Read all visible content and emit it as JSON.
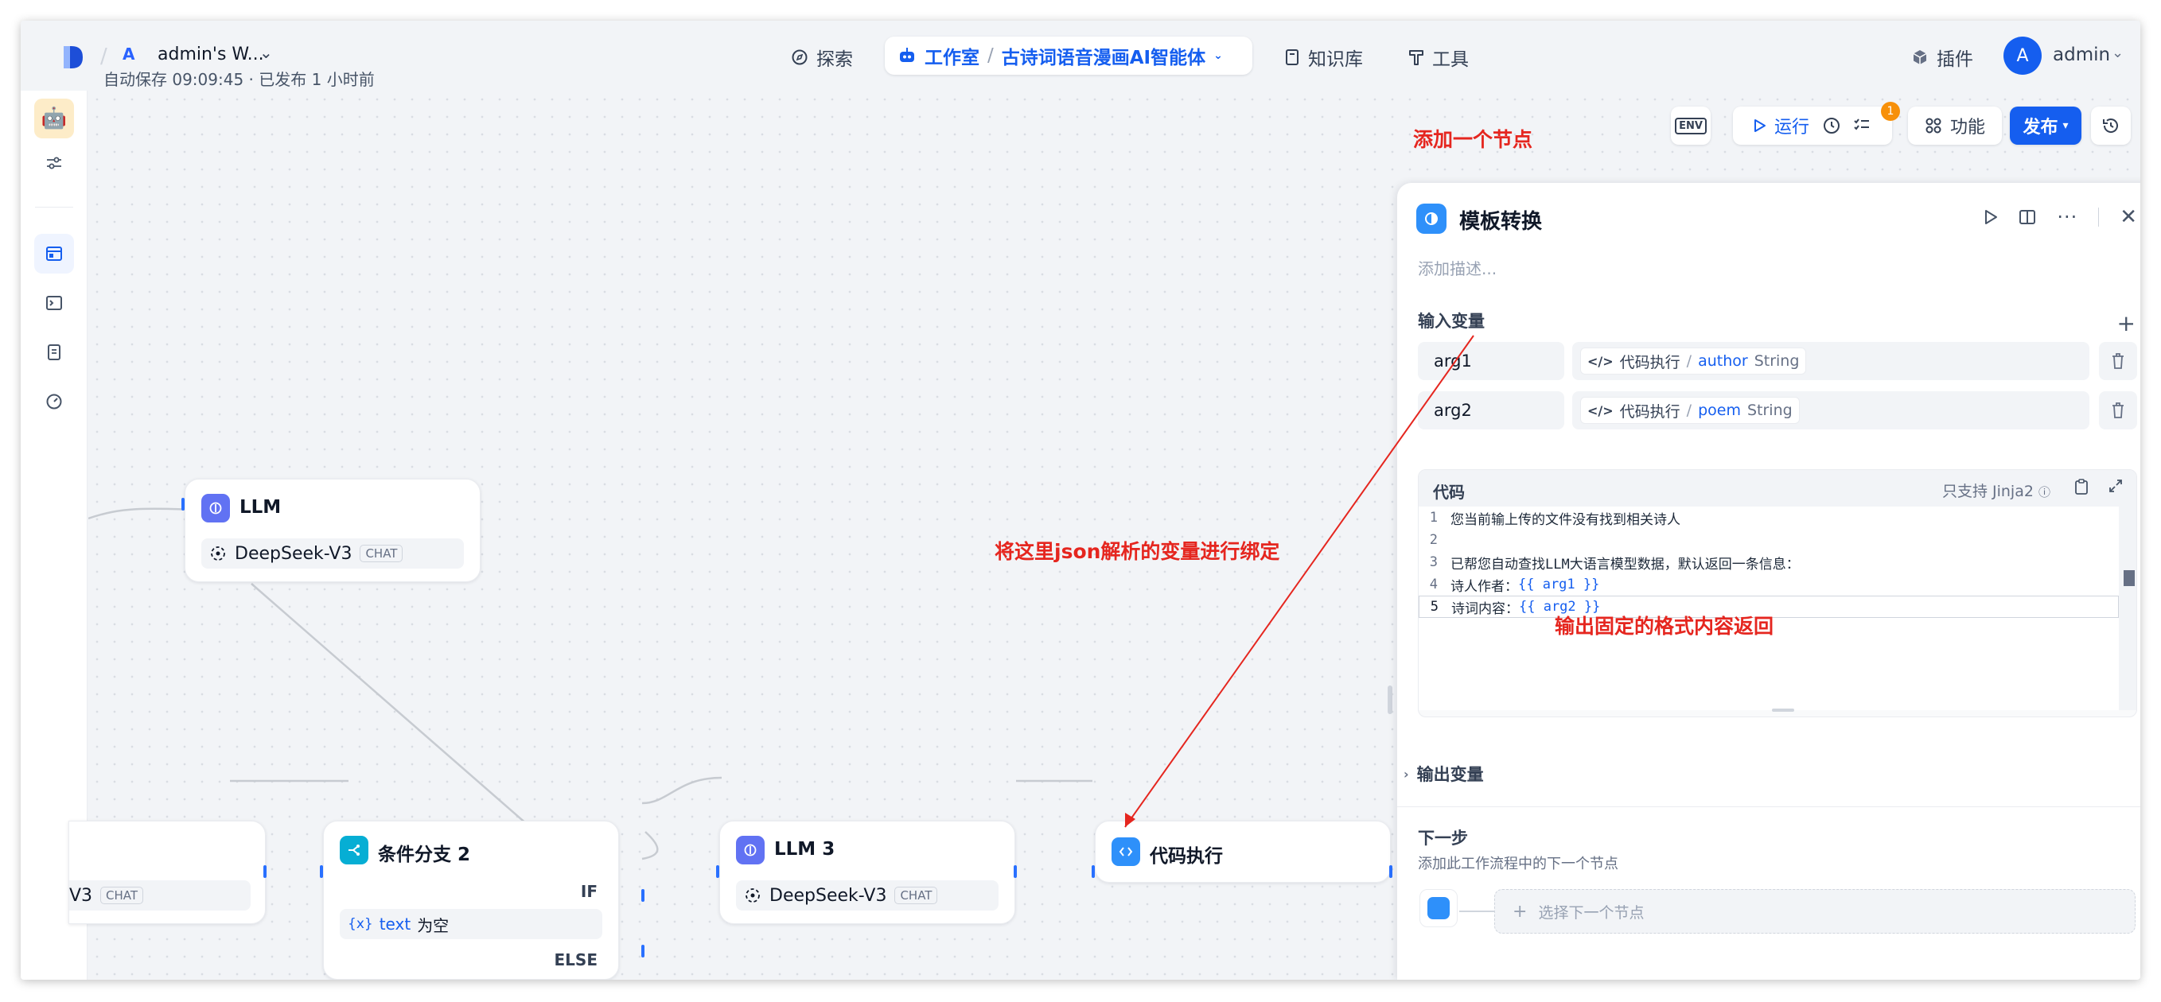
{
  "topbar": {
    "workspace_badge": "A",
    "workspace_name": "admin's W...",
    "nav_explore": "探索",
    "nav_studio": "工作室",
    "app_name": "古诗词语音漫画AI智能体",
    "nav_knowledge": "知识库",
    "nav_tools": "工具",
    "plugins": "插件",
    "avatar_letter": "A",
    "user_name": "admin"
  },
  "canvas": {
    "autosave": "自动保存 09:09:45 · 已发布 1 小时前"
  },
  "toolbar": {
    "env_label": "ENV",
    "run_label": "运行",
    "checklist_badge": "1",
    "features_label": "功能",
    "publish_label": "发布"
  },
  "annotations": {
    "add_node": "添加一个节点",
    "bind_vars": "将这里json解析的变量进行绑定",
    "output_format": "输出固定的格式内容返回"
  },
  "nodes": {
    "llm_top": {
      "title": "LLM",
      "model": "DeepSeek-V3",
      "tag": "CHAT"
    },
    "left_partial": {
      "model": "V3",
      "tag": "CHAT"
    },
    "if_else": {
      "title": "条件分支 2",
      "if_label": "IF",
      "else_label": "ELSE",
      "cond_var_icon": "{x}",
      "cond_var": "text",
      "cond_op": "为空"
    },
    "llm3": {
      "title": "LLM 3",
      "model": "DeepSeek-V3",
      "tag": "CHAT"
    },
    "code_exec": {
      "title": "代码执行"
    }
  },
  "panel": {
    "title": "模板转换",
    "description_placeholder": "添加描述...",
    "input_vars_label": "输入变量",
    "vars": [
      {
        "name": "arg1",
        "source": "代码执行",
        "field": "author",
        "type": "String"
      },
      {
        "name": "arg2",
        "source": "代码执行",
        "field": "poem",
        "type": "String"
      }
    ],
    "code_label": "代码",
    "code_note": "只支持 Jinja2",
    "code_lines": [
      {
        "num": "1",
        "text": "您当前输上传的文件没有找到相关诗人"
      },
      {
        "num": "2",
        "text": ""
      },
      {
        "num": "3",
        "text": "已帮您自动查找LLM大语言模型数据，默认返回一条信息："
      },
      {
        "num": "4",
        "prefix": "诗人作者：",
        "tpl": "{{ arg1 }}"
      },
      {
        "num": "5",
        "prefix": "诗词内容：",
        "tpl": "{{ arg2 }}"
      }
    ],
    "output_vars_label": "输出变量",
    "next_label": "下一步",
    "next_sub": "添加此工作流程中的下一个节点",
    "next_select": "选择下一个节点"
  },
  "colors": {
    "accent": "#155eef",
    "annotation": "#e5261f",
    "node_llm": "#6172f3",
    "node_ifelse": "#06aed4",
    "node_code": "#2e90fa"
  }
}
